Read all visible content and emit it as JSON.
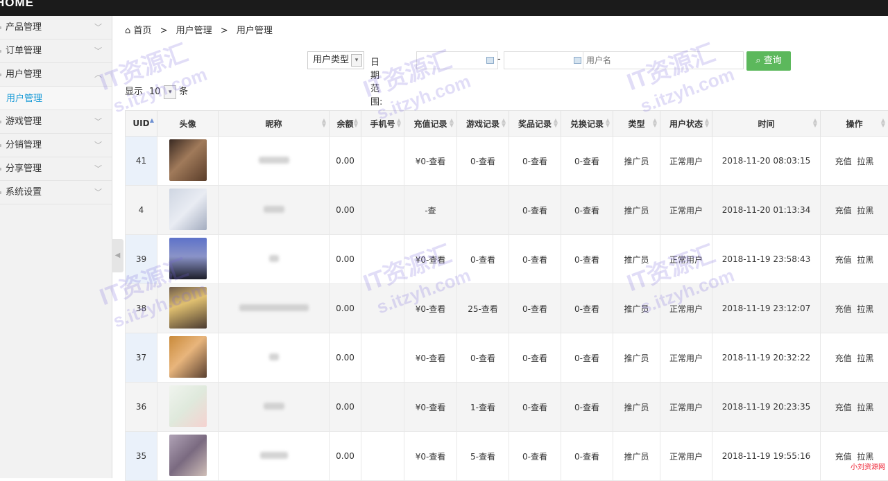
{
  "header": {
    "brand": "HOME"
  },
  "sidebar": {
    "items": [
      {
        "label": "产品管理"
      },
      {
        "label": "订单管理"
      },
      {
        "label": "用户管理",
        "sub": "用户管理"
      },
      {
        "label": "游戏管理"
      },
      {
        "label": "分销管理"
      },
      {
        "label": "分享管理"
      },
      {
        "label": "系统设置"
      }
    ]
  },
  "breadcrumb": {
    "home": "首页",
    "level1": "用户管理",
    "level2": "用户管理",
    "sep": ">"
  },
  "filter": {
    "type_select": "用户类型",
    "date_label": "日期范围:",
    "dash": "-",
    "name_placeholder": "用户名",
    "search_label": "查询"
  },
  "pager": {
    "show": "显示",
    "size": "10",
    "unit": "条"
  },
  "table": {
    "columns": [
      "UID",
      "头像",
      "昵称",
      "余额",
      "手机号",
      "充值记录",
      "游戏记录",
      "奖品记录",
      "兑换记录",
      "类型",
      "用户状态",
      "时间",
      "操作"
    ],
    "actions": {
      "recharge": "充值",
      "block": "拉黑"
    },
    "rows": [
      {
        "uid": "41",
        "balance": "0.00",
        "phone": "",
        "recharge": "¥0-查看",
        "game": "0-查看",
        "prize": "0-查看",
        "exchange": "0-查看",
        "type": "推广员",
        "status": "正常用户",
        "time": "2018-11-20 08:03:15"
      },
      {
        "uid": "4",
        "balance": "0.00",
        "phone": "",
        "recharge": "-查",
        "game": "",
        "prize": "0-查看",
        "exchange": "0-查看",
        "type": "推广员",
        "status": "正常用户",
        "time": "2018-11-20 01:13:34"
      },
      {
        "uid": "39",
        "balance": "0.00",
        "phone": "",
        "recharge": "¥0-查看",
        "game": "0-查看",
        "prize": "0-查看",
        "exchange": "0-查看",
        "type": "推广员",
        "status": "正常用户",
        "time": "2018-11-19 23:58:43"
      },
      {
        "uid": "38",
        "balance": "0.00",
        "phone": "",
        "recharge": "¥0-查看",
        "game": "25-查看",
        "prize": "0-查看",
        "exchange": "0-查看",
        "type": "推广员",
        "status": "正常用户",
        "time": "2018-11-19 23:12:07"
      },
      {
        "uid": "37",
        "balance": "0.00",
        "phone": "",
        "recharge": "¥0-查看",
        "game": "0-查看",
        "prize": "0-查看",
        "exchange": "0-查看",
        "type": "推广员",
        "status": "正常用户",
        "time": "2018-11-19 20:32:22"
      },
      {
        "uid": "36",
        "balance": "0.00",
        "phone": "",
        "recharge": "¥0-查看",
        "game": "1-查看",
        "prize": "0-查看",
        "exchange": "0-查看",
        "type": "推广员",
        "status": "正常用户",
        "time": "2018-11-19 20:23:35"
      },
      {
        "uid": "35",
        "balance": "0.00",
        "phone": "",
        "recharge": "¥0-查看",
        "game": "5-查看",
        "prize": "0-查看",
        "exchange": "0-查看",
        "type": "推广员",
        "status": "正常用户",
        "time": "2018-11-19 19:55:16"
      }
    ]
  },
  "watermark": {
    "text1": "IT资源汇",
    "text2": "s.itzyh.com",
    "corner": "小刘资源网"
  },
  "colors": {
    "accent": "#1a9bd7",
    "search_button": "#5cb85c",
    "topbar": "#1b1b1b"
  }
}
